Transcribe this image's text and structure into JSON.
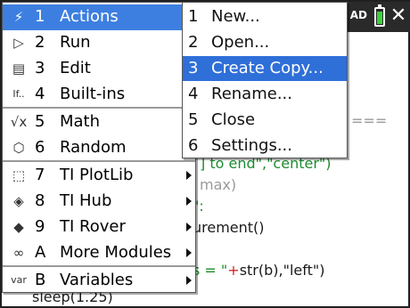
{
  "topbar": {
    "status_text": "AD",
    "close_symbol": "✕"
  },
  "code_lines": [
    {
      "prefix": "",
      "str": "",
      "rest": "==="
    },
    {
      "prefix": "",
      "str": "] to end\",\"center\")",
      "rest": ""
    },
    {
      "prefix": "max)",
      "str": "",
      "rest": ""
    },
    {
      "prefix": "\":",
      "str": "",
      "rest": ""
    },
    {
      "prefix": "urement()",
      "str": "",
      "rest": ""
    },
    {
      "prefix": "s = \"",
      "op": "+",
      "rest": "str(b),\"left\")"
    },
    {
      "prefix": "sleep(1.25)",
      "str": "",
      "rest": ""
    }
  ],
  "main_menu": {
    "items": [
      {
        "icon": "⚡",
        "key": "1",
        "label": "Actions",
        "selected": true,
        "has_submenu": true
      },
      {
        "icon": "▷",
        "key": "2",
        "label": "Run",
        "selected": false,
        "has_submenu": false
      },
      {
        "icon": "▤",
        "key": "3",
        "label": "Edit",
        "selected": false,
        "has_submenu": false
      },
      {
        "icon": "If..",
        "key": "4",
        "label": "Built-ins",
        "selected": false,
        "has_submenu": false
      },
      {
        "icon": "√x",
        "key": "5",
        "label": "Math",
        "selected": false,
        "has_submenu": false
      },
      {
        "icon": "⬡",
        "key": "6",
        "label": "Random",
        "selected": false,
        "has_submenu": false
      },
      {
        "icon": "⬚",
        "key": "7",
        "label": "TI PlotLib",
        "selected": false,
        "has_submenu": true
      },
      {
        "icon": "◈",
        "key": "8",
        "label": "TI Hub",
        "selected": false,
        "has_submenu": true
      },
      {
        "icon": "◆",
        "key": "9",
        "label": "TI Rover",
        "selected": false,
        "has_submenu": true
      },
      {
        "icon": "∞",
        "key": "A",
        "label": "More Modules",
        "selected": false,
        "has_submenu": true
      },
      {
        "icon": "var",
        "key": "B",
        "label": "Variables",
        "selected": false,
        "has_submenu": true
      }
    ]
  },
  "sub_menu": {
    "items": [
      {
        "key": "1",
        "label": "New...",
        "selected": false
      },
      {
        "key": "2",
        "label": "Open...",
        "selected": false
      },
      {
        "key": "3",
        "label": "Create Copy...",
        "selected": true
      },
      {
        "key": "4",
        "label": "Rename...",
        "selected": false
      },
      {
        "key": "5",
        "label": "Close",
        "selected": false
      },
      {
        "key": "6",
        "label": "Settings...",
        "selected": false
      }
    ]
  },
  "colors": {
    "selection": "#3d7fe0",
    "string_green": "#1d8b2e",
    "operator_red": "#cf2828"
  }
}
